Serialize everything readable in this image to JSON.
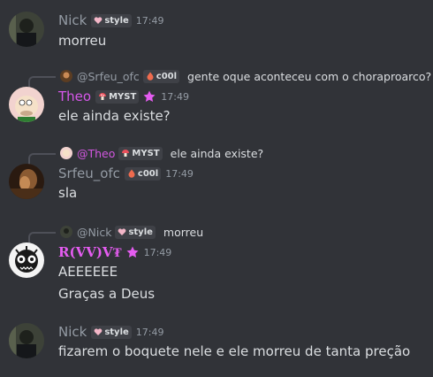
{
  "messages": [
    {
      "author": "Nick",
      "tag": "style",
      "time": "17:49",
      "lines": [
        "morreu"
      ]
    },
    {
      "reply": {
        "name": "@Srfeu_ofc",
        "tag": "c00l",
        "text": "gente oque aconteceu com o choraproarco?"
      },
      "author": "Theo",
      "tag": "MYST",
      "time": "17:49",
      "lines": [
        "ele ainda existe?"
      ]
    },
    {
      "reply": {
        "name": "@Theo",
        "tag": "MYST",
        "text": "ele ainda existe?"
      },
      "author": "Srfeu_ofc",
      "tag": "c00l",
      "time": "17:49",
      "lines": [
        "sla"
      ]
    },
    {
      "reply": {
        "name": "@Nick",
        "tag": "style",
        "text": "morreu"
      },
      "author": "R(VV)V₮",
      "time": "17:49",
      "lines": [
        "AEEEEEE",
        "Graças a Deus"
      ]
    },
    {
      "author": "Nick",
      "tag": "style",
      "time": "17:49",
      "lines": [
        "fizarem o boquete nele e ele morreu de tanta preção"
      ]
    }
  ],
  "colors": {
    "background": "#313338",
    "theo_pink": "#d657ea",
    "rvvv_pink": "#e45cf0",
    "muted": "#949ba4",
    "text": "#dbdee1"
  },
  "icons": {
    "style_tag": "heart-icon",
    "myst_tag": "mushroom-icon",
    "cool_tag": "flame-icon",
    "badge": "star-badge-icon"
  }
}
